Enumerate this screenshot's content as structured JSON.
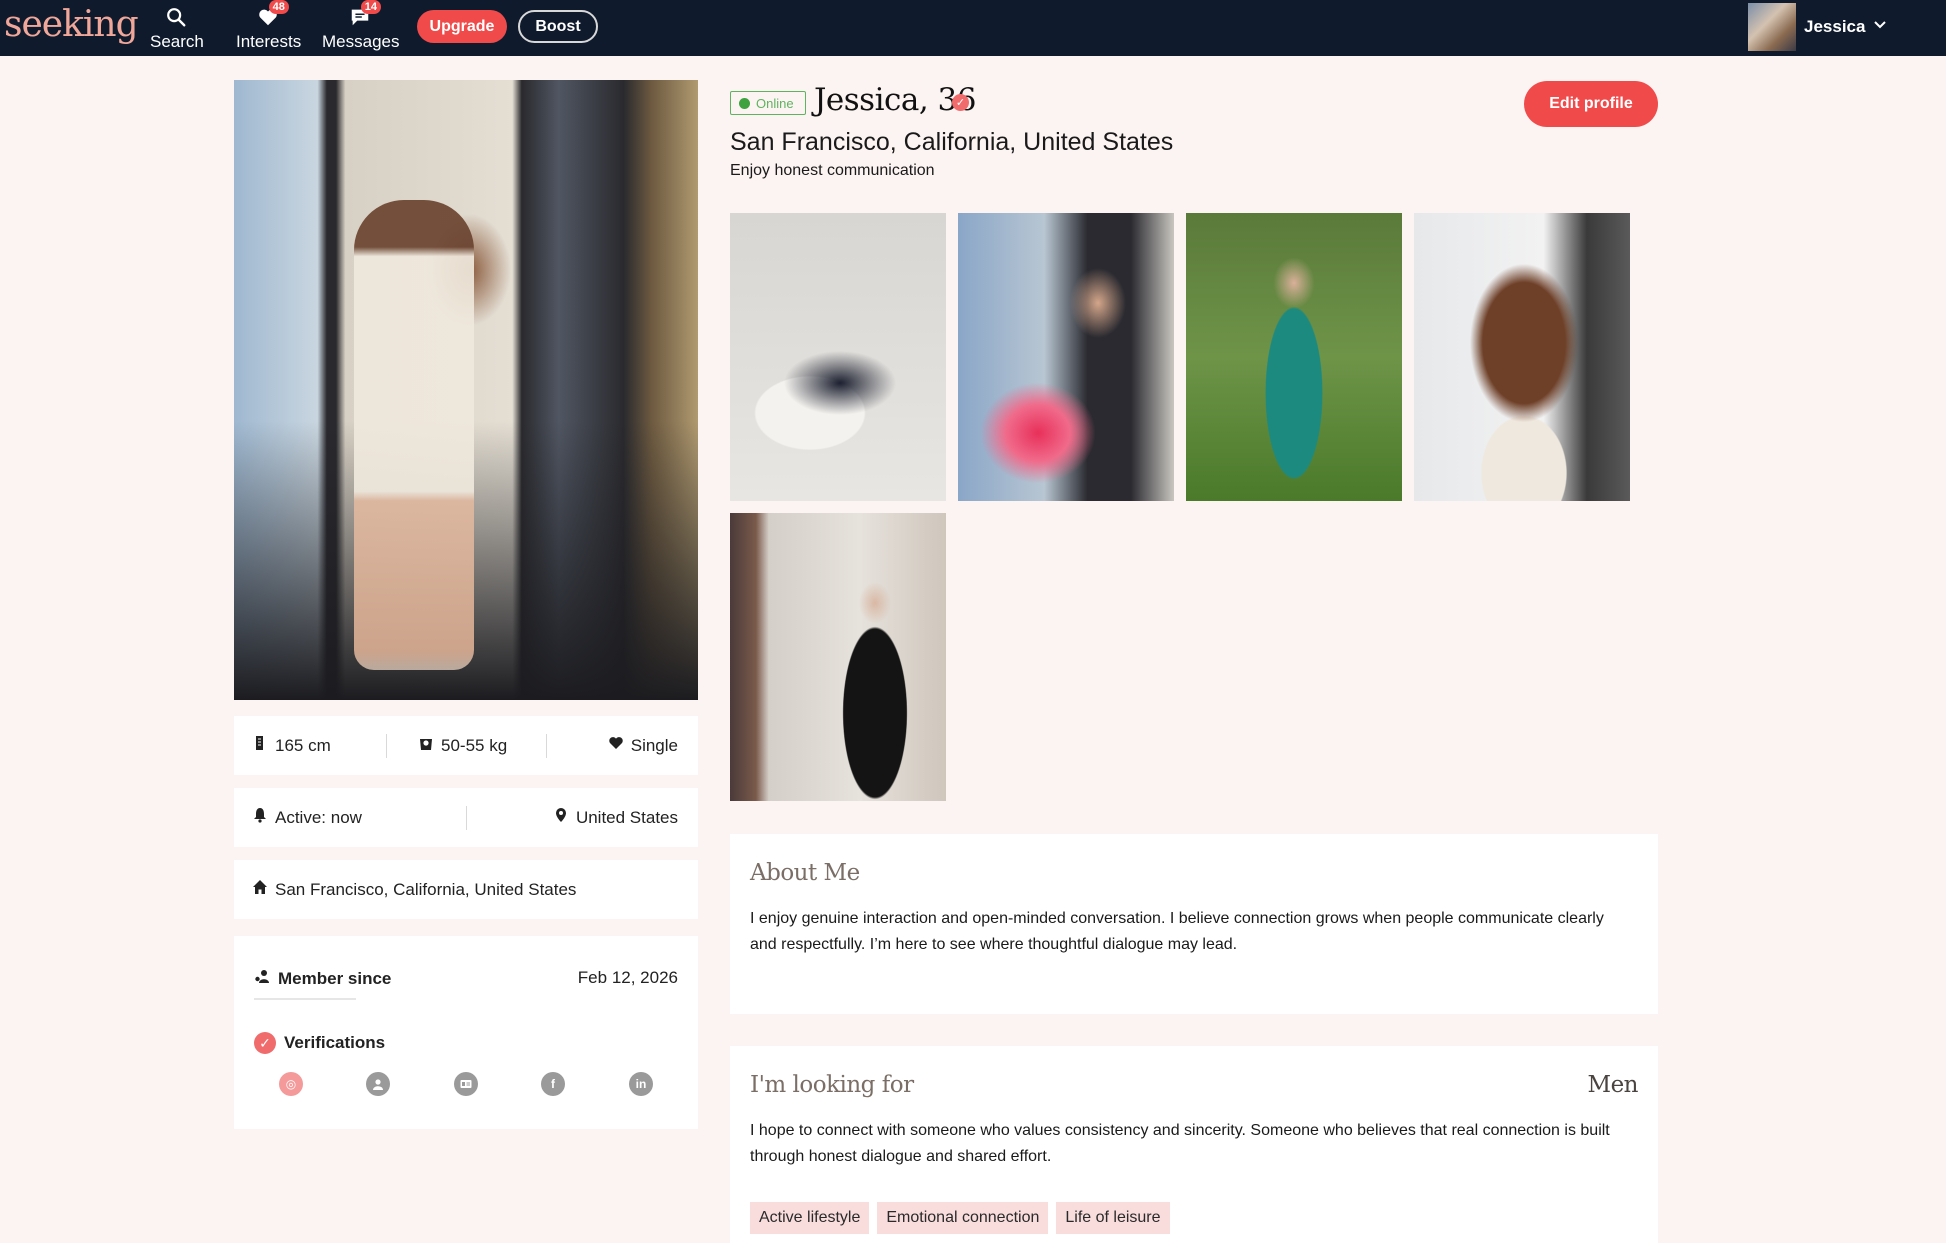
{
  "nav": {
    "logo": "seeking",
    "search_label": "Search",
    "interests_label": "Interests",
    "interests_badge": "48",
    "messages_label": "Messages",
    "messages_badge": "14",
    "upgrade_label": "Upgrade",
    "boost_label": "Boost",
    "user_name": "Jessica"
  },
  "profile": {
    "status": "Online",
    "name_age": "Jessica, 36",
    "location": "San Francisco, California, United States",
    "tagline": "Enjoy honest communication",
    "edit_label": "Edit profile"
  },
  "stats": {
    "height": "165 cm",
    "weight": "50-55 kg",
    "relationship": "Single",
    "active": "Active: now",
    "country": "United States",
    "city": "San Francisco, California, United States"
  },
  "member": {
    "label": "Member since",
    "date": "Feb 12, 2026",
    "verifications_label": "Verifications",
    "verification_icons": [
      "photo-verified-icon",
      "profile-icon",
      "id-card-icon",
      "facebook-icon",
      "linkedin-icon"
    ]
  },
  "about": {
    "title": "About Me",
    "text": "I enjoy genuine interaction and open-minded conversation. I believe connection grows when people communicate clearly and respectfully. I’m here to see where thoughtful dialogue may lead."
  },
  "looking": {
    "title": "I'm looking for",
    "target": "Men",
    "text": "I hope to connect with someone who values consistency and sincerity. Someone who believes that real connection is built through honest dialogue and shared effort.",
    "tags": [
      "Active lifestyle",
      "Emotional connection",
      "Life of leisure"
    ]
  },
  "colors": {
    "nav_bg": "#0f1b2d",
    "accent": "#f04a4a",
    "page_bg": "#fcf4f2",
    "online": "#3ea33e",
    "tag_bg": "#f9dcdc"
  }
}
